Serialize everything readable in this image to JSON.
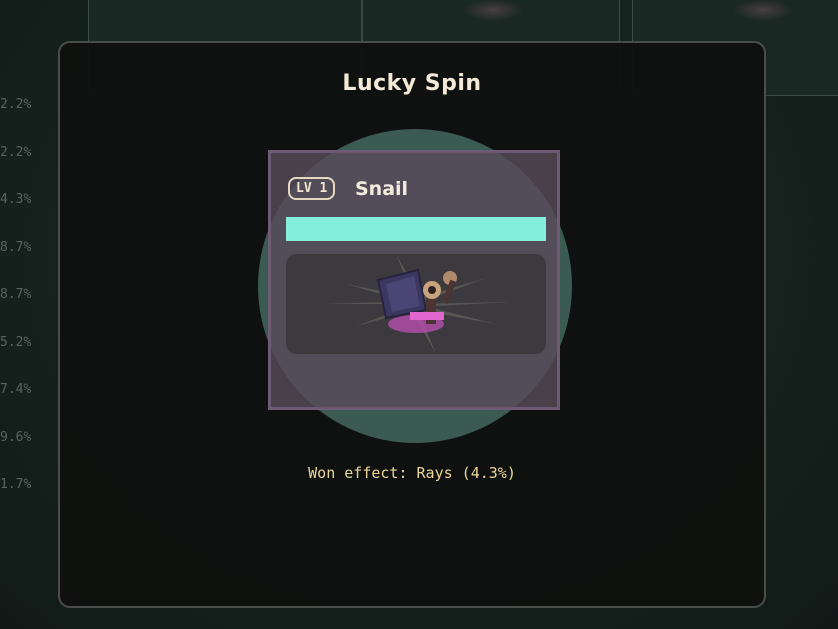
{
  "background": {
    "percent_column": [
      "2.2%",
      "2.2%",
      "4.3%",
      "8.7%",
      "8.7%",
      "5.2%",
      "7.4%",
      "9.6%",
      "1.7%"
    ]
  },
  "modal": {
    "title": "Lucky Spin",
    "item": {
      "level": "LV 1",
      "name": "Snail",
      "hp_fill_fraction": 1.0,
      "sprite_icon": "snail-sprite-icon",
      "effect_icon": "rays-effect-icon"
    },
    "result_text": "Won effect: Rays (4.3%)"
  },
  "colors": {
    "modal_bg": "#0f1110",
    "title": "#f3ead8",
    "glow_circle": "#3a5a52",
    "card_border": "#6d5a73",
    "hp_bar": "#83eedb",
    "result_text": "#ecd59a"
  }
}
